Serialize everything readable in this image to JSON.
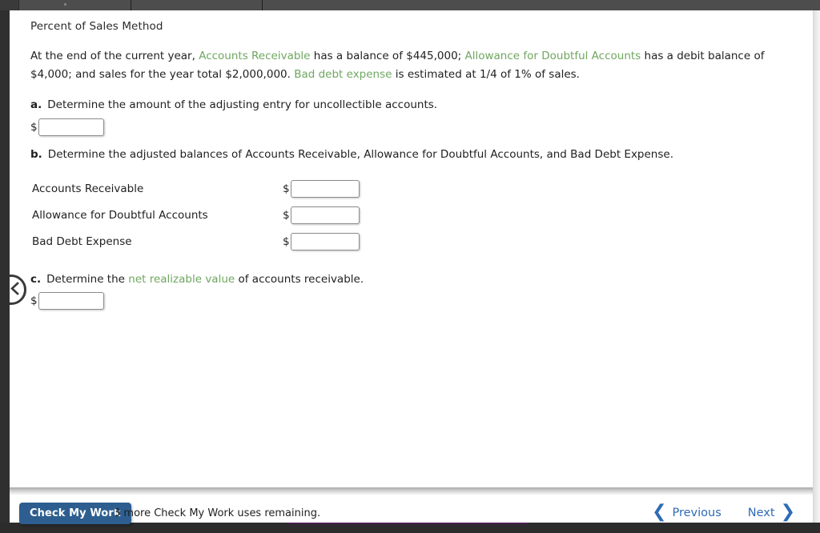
{
  "toolbar": {
    "segments": [
      "",
      "",
      "",
      ""
    ]
  },
  "exercise": {
    "title": "Percent of Sales Method",
    "prompt": {
      "t1": "At the end of the current year, ",
      "term1": "Accounts Receivable",
      "t2": " has a balance of $445,000; ",
      "term2": "Allowance for Doubtful Accounts",
      "t3": " has a debit balance of $4,000; and sales for the year total $2,000,000. ",
      "term3": "Bad debt expense",
      "t4": " is estimated at 1/4 of 1% of sales."
    },
    "parts": {
      "a": {
        "label": "a.",
        "text": "Determine the amount of the adjusting entry for uncollectible accounts.",
        "currency": "$",
        "answer": "",
        "placeholder": ""
      },
      "b": {
        "label": "b.",
        "text": "Determine the adjusted balances of Accounts Receivable, Allowance for Doubtful Accounts, and Bad Debt Expense.",
        "rows": [
          {
            "name": "Accounts Receivable",
            "currency": "$",
            "answer": "",
            "placeholder": ""
          },
          {
            "name": "Allowance for Doubtful Accounts",
            "currency": "$",
            "answer": "",
            "placeholder": ""
          },
          {
            "name": "Bad Debt Expense",
            "currency": "$",
            "answer": "",
            "placeholder": ""
          }
        ]
      },
      "c": {
        "label": "c.",
        "text_before": "Determine the ",
        "term": "net realizable value",
        "text_after": " of accounts receivable.",
        "currency": "$",
        "answer": "",
        "placeholder": ""
      }
    }
  },
  "side_nav": {
    "prev_panel_icon": "chevron-left-icon"
  },
  "footer": {
    "check_my_work_label": "Check My Work",
    "uses_remaining_note": "3 more Check My Work uses remaining.",
    "previous_label": "Previous",
    "next_label": "Next",
    "previous_icon": "chevron-left-icon",
    "next_icon": "chevron-right-icon"
  },
  "colors": {
    "term_green": "#6fa760",
    "link_blue": "#2f6bb5",
    "button_blue": "#2d5e8f",
    "chrome_dark": "#2f2f2f"
  }
}
